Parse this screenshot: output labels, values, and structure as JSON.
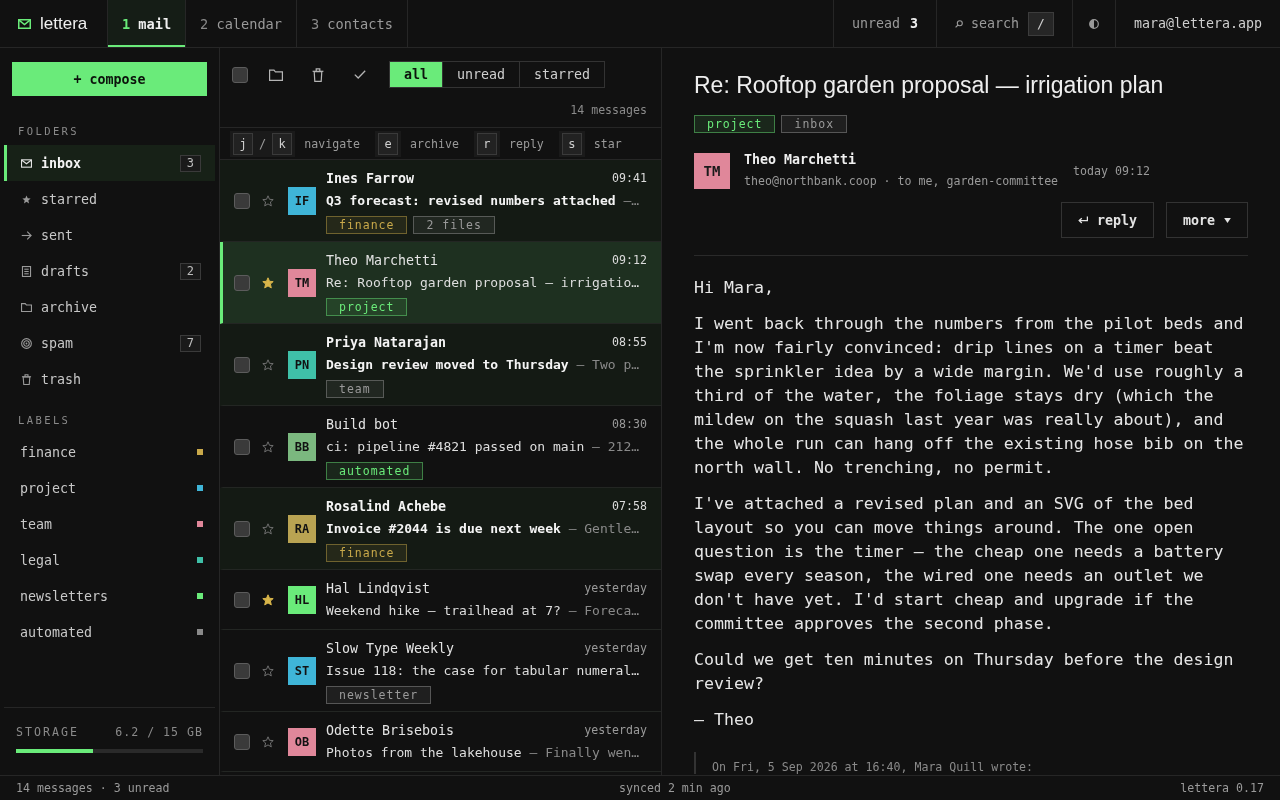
{
  "topbar": {
    "brand": "lettera",
    "tabs": [
      {
        "key": "1",
        "label": "mail",
        "selected": true
      },
      {
        "key": "2",
        "label": "calendar",
        "selected": false
      },
      {
        "key": "3",
        "label": "contacts",
        "selected": false
      }
    ],
    "unread": {
      "label": "unread",
      "count": "3"
    },
    "search": {
      "label": "search",
      "shortcut": "/"
    },
    "account": "mara@lettera.app"
  },
  "sidebar": {
    "compose": "+ compose",
    "folders_heading": "FOLDERS",
    "folders": [
      {
        "kind": "mail",
        "label": "inbox",
        "count": "3",
        "selected": true
      },
      {
        "kind": "star",
        "label": "starred",
        "selected": false
      },
      {
        "kind": "arrow",
        "label": "sent",
        "selected": false
      },
      {
        "kind": "document",
        "label": "drafts",
        "count": "2",
        "selected": false
      },
      {
        "kind": "folder",
        "label": "archive",
        "selected": false
      },
      {
        "kind": "target",
        "label": "spam",
        "count": "7",
        "selected": false
      },
      {
        "kind": "trash",
        "label": "trash",
        "selected": false
      }
    ],
    "labels_heading": "LABELS",
    "labels": [
      {
        "label": "finance",
        "color": "#c9a94a"
      },
      {
        "label": "project",
        "color": "#3fb5d8"
      },
      {
        "label": "team",
        "color": "#e0879a"
      },
      {
        "label": "legal",
        "color": "#3fc0a8"
      },
      {
        "label": "newsletters",
        "color": "#6aeb7a"
      },
      {
        "label": "automated",
        "color": "#8a8a8a"
      }
    ],
    "storage": {
      "label": "STORAGE",
      "reading": "6.2 / 15 GB",
      "level": 0.41
    }
  },
  "list": {
    "select_all_checked": false,
    "filters": [
      {
        "label": "all",
        "selected": true
      },
      {
        "label": "unread",
        "selected": false
      },
      {
        "label": "starred",
        "selected": false
      }
    ],
    "count": "14 messages",
    "shortcuts": [
      {
        "keys": [
          "j",
          "k"
        ],
        "joiner": "/",
        "label": "navigate"
      },
      {
        "keys": [
          "e"
        ],
        "label": "archive"
      },
      {
        "keys": [
          "r"
        ],
        "label": "reply"
      },
      {
        "keys": [
          "s"
        ],
        "label": "star"
      }
    ],
    "messages": [
      {
        "sender": "Ines Farrow",
        "time": "09:41",
        "subject": "Q3 forecast: revised numbers attached",
        "preview": "—…",
        "initials": "IF",
        "color": "#3fb5d8",
        "unread": true,
        "starred": false,
        "selected": false,
        "checked": false,
        "tags": [
          {
            "label": "finance",
            "color": "#c9a94a"
          },
          {
            "label": "2 files",
            "color": "#9a9a9a"
          }
        ]
      },
      {
        "sender": "Theo Marchetti",
        "time": "09:12",
        "subject": "Re: Rooftop garden proposal — irrigatio…",
        "initials": "TM",
        "color": "#e0879a",
        "unread": false,
        "starred": true,
        "selected": true,
        "checked": false,
        "tags": [
          {
            "label": "project",
            "color": "#6aeb7a"
          }
        ]
      },
      {
        "sender": "Priya Natarajan",
        "time": "08:55",
        "subject": "Design review moved to Thursday",
        "preview": "— Two p…",
        "initials": "PN",
        "color": "#3fc0a8",
        "unread": true,
        "starred": false,
        "selected": false,
        "checked": false,
        "tags": [
          {
            "label": "team",
            "color": "#9a9a9a"
          }
        ]
      },
      {
        "sender": "Build bot",
        "time": "08:30",
        "subject": "ci: pipeline #4821 passed on main",
        "preview": "— 212…",
        "initials": "BB",
        "color": "#7bb87f",
        "unread": false,
        "starred": false,
        "selected": false,
        "checked": false,
        "tags": [
          {
            "label": "automated",
            "color": "#6aeb7a"
          }
        ]
      },
      {
        "sender": "Rosalind Achebe",
        "time": "07:58",
        "subject": "Invoice #2044 is due next week",
        "preview": "— Gentle…",
        "initials": "RA",
        "color": "#b9a352",
        "unread": true,
        "starred": false,
        "selected": false,
        "checked": false,
        "tags": [
          {
            "label": "finance",
            "color": "#c9a94a"
          }
        ]
      },
      {
        "sender": "Hal Lindqvist",
        "time": "yesterday",
        "subject": "Weekend hike — trailhead at 7?",
        "preview": "— Foreca…",
        "initials": "HL",
        "color": "#6aeb7a",
        "unread": false,
        "starred": true,
        "selected": false,
        "checked": false
      },
      {
        "sender": "Slow Type Weekly",
        "time": "yesterday",
        "subject": "Issue 118: the case for tabular numeral…",
        "initials": "ST",
        "color": "#3fb5d8",
        "unread": false,
        "starred": false,
        "selected": false,
        "checked": false,
        "tags": [
          {
            "label": "newsletter",
            "color": "#9a9a9a"
          }
        ]
      },
      {
        "sender": "Odette Brisebois",
        "time": "yesterday",
        "subject": "Photos from the lakehouse",
        "preview": "— Finally wen…",
        "initials": "OB",
        "color": "#e0879a",
        "unread": false,
        "starred": false,
        "selected": false,
        "checked": false
      }
    ]
  },
  "reader": {
    "title": "Re: Rooftop garden proposal — irrigation plan",
    "tags": [
      {
        "label": "project",
        "color": "#6aeb7a"
      },
      {
        "label": "inbox",
        "color": "#9a9a9a"
      }
    ],
    "sender": {
      "initials": "TM",
      "color": "#e0879a",
      "name": "Theo Marchetti",
      "meta": "theo@northbank.coop · to me, garden-committee",
      "date": "today 09:12"
    },
    "actions": [
      {
        "kind": "reply",
        "label": "reply"
      },
      {
        "kind": "more",
        "label": "more"
      }
    ],
    "body": [
      "Hi Mara,",
      "I went back through the numbers from the pilot beds and I'm now fairly convinced: drip lines on a timer beat the sprinkler idea by a wide margin. We'd use roughly a third of the water, the foliage stays dry (which the mildew on the squash last year was really about), and the whole run can hang off the existing hose bib on the north wall. No trenching, no permit.",
      "I've attached a revised plan and an SVG of the bed layout so you can move things around. The one open question is the timer — the cheap one needs a battery swap every season, the wired one needs an outlet we don't have yet. I'd start cheap and upgrade if the committee approves the second phase.",
      "Could we get ten minutes on Thursday before the design review?",
      "— Theo"
    ],
    "quote": "On Fri, 5 Sep 2026 at 16:40, Mara Quill wrote:"
  },
  "status_bar": {
    "left": "14 messages · 3 unread",
    "center": "synced 2 min ago",
    "right": "lettera 0.17"
  }
}
